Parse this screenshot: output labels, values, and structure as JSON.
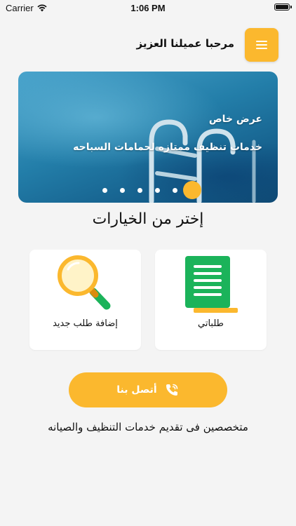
{
  "status_bar": {
    "carrier": "Carrier",
    "time": "1:06 PM"
  },
  "header": {
    "greeting": "مرحبا عميلنا العزيز"
  },
  "banner": {
    "title": "عرض خاص",
    "subtitle": "خدمات تنظيف ممتازه لحمامات السباحه",
    "dots_count": 6,
    "active_dot": 0
  },
  "section_title": "إختر من الخيارات",
  "options": [
    {
      "label": "طلباتي",
      "icon": "orders-list-icon"
    },
    {
      "label": "إضافة طلب جديد",
      "icon": "magnifier-icon"
    }
  ],
  "contact": {
    "label": "أتصل بنا",
    "icon": "phone-icon"
  },
  "tagline": "متخصصين فى تقديم خدمات التنظيف والصيانه",
  "colors": {
    "accent": "#fbb82e",
    "green": "#1bb35a",
    "background": "#f4f4f4"
  }
}
